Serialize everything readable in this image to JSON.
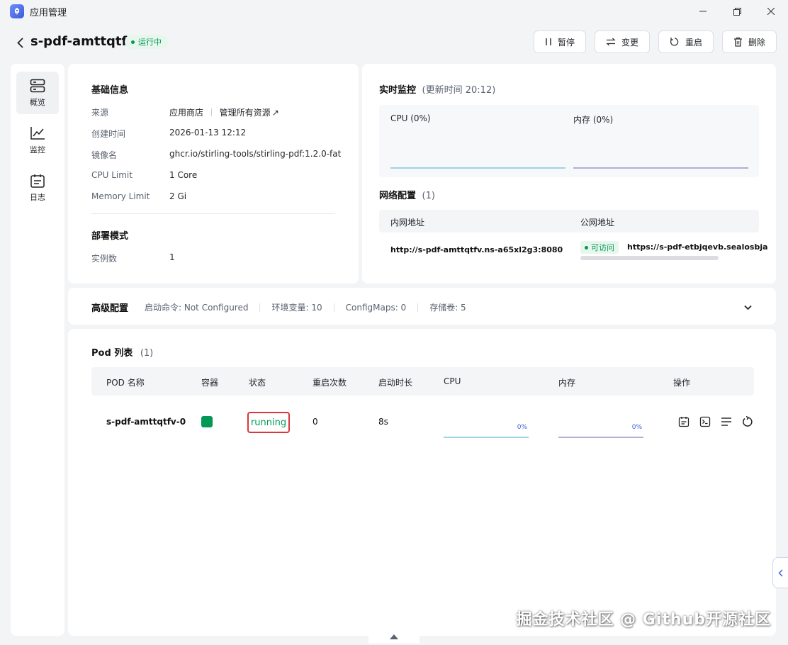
{
  "window": {
    "title": "应用管理"
  },
  "header": {
    "app_name": "s-pdf-amttqtfv",
    "status": "运行中",
    "actions": {
      "pause": "暂停",
      "change": "变更",
      "restart": "重启",
      "delete": "删除"
    }
  },
  "sidebar": {
    "items": [
      {
        "label": "概览",
        "icon": "server-icon"
      },
      {
        "label": "监控",
        "icon": "chart-icon"
      },
      {
        "label": "日志",
        "icon": "log-icon"
      }
    ]
  },
  "basic_info": {
    "title": "基础信息",
    "source_label": "来源",
    "source_value": "应用商店",
    "manage_link": "管理所有资源",
    "created_label": "创建时间",
    "created_value": "2026-01-13 12:12",
    "image_label": "镜像名",
    "image_value": "ghcr.io/stirling-tools/stirling-pdf:1.2.0-fat",
    "cpu_label": "CPU Limit",
    "cpu_value": "1 Core",
    "mem_label": "Memory Limit",
    "mem_value": "2 Gi",
    "deploy_title": "部署模式",
    "instances_label": "实例数",
    "instances_value": "1"
  },
  "monitor": {
    "title": "实时监控",
    "update_time": "(更新时间  20:12)",
    "cpu_label": "CPU  (0%)",
    "mem_label": "内存  (0%)"
  },
  "network": {
    "title": "网络配置",
    "count": "(1)",
    "col_private": "内网地址",
    "col_public": "公网地址",
    "private_addr": "http://s-pdf-amttqtfv.ns-a65xl2g3:8080",
    "access_badge": "可访问",
    "public_addr": "https://s-pdf-etbjqevb.sealosbja"
  },
  "advanced": {
    "title": "高级配置",
    "start_cmd": "启动命令: Not Configured",
    "env": "环境变量: 10",
    "configmaps": "ConfigMaps: 0",
    "storage": "存储卷: 5"
  },
  "pods": {
    "title": "Pod 列表",
    "count": "(1)",
    "columns": [
      "POD 名称",
      "容器",
      "状态",
      "重启次数",
      "启动时长",
      "CPU",
      "内存",
      "操作"
    ],
    "rows": [
      {
        "name": "s-pdf-amttqtfv-0",
        "status": "running",
        "restarts": "0",
        "uptime": "8s",
        "cpu": "0%",
        "mem": "0%"
      }
    ]
  },
  "watermark": "掘金技术社区 @ Github开源社区",
  "colors": {
    "success": "#039855",
    "cpu_line": "#9fd3e8",
    "mem_line": "#b3b0d6",
    "highlight": "#d9363e"
  }
}
